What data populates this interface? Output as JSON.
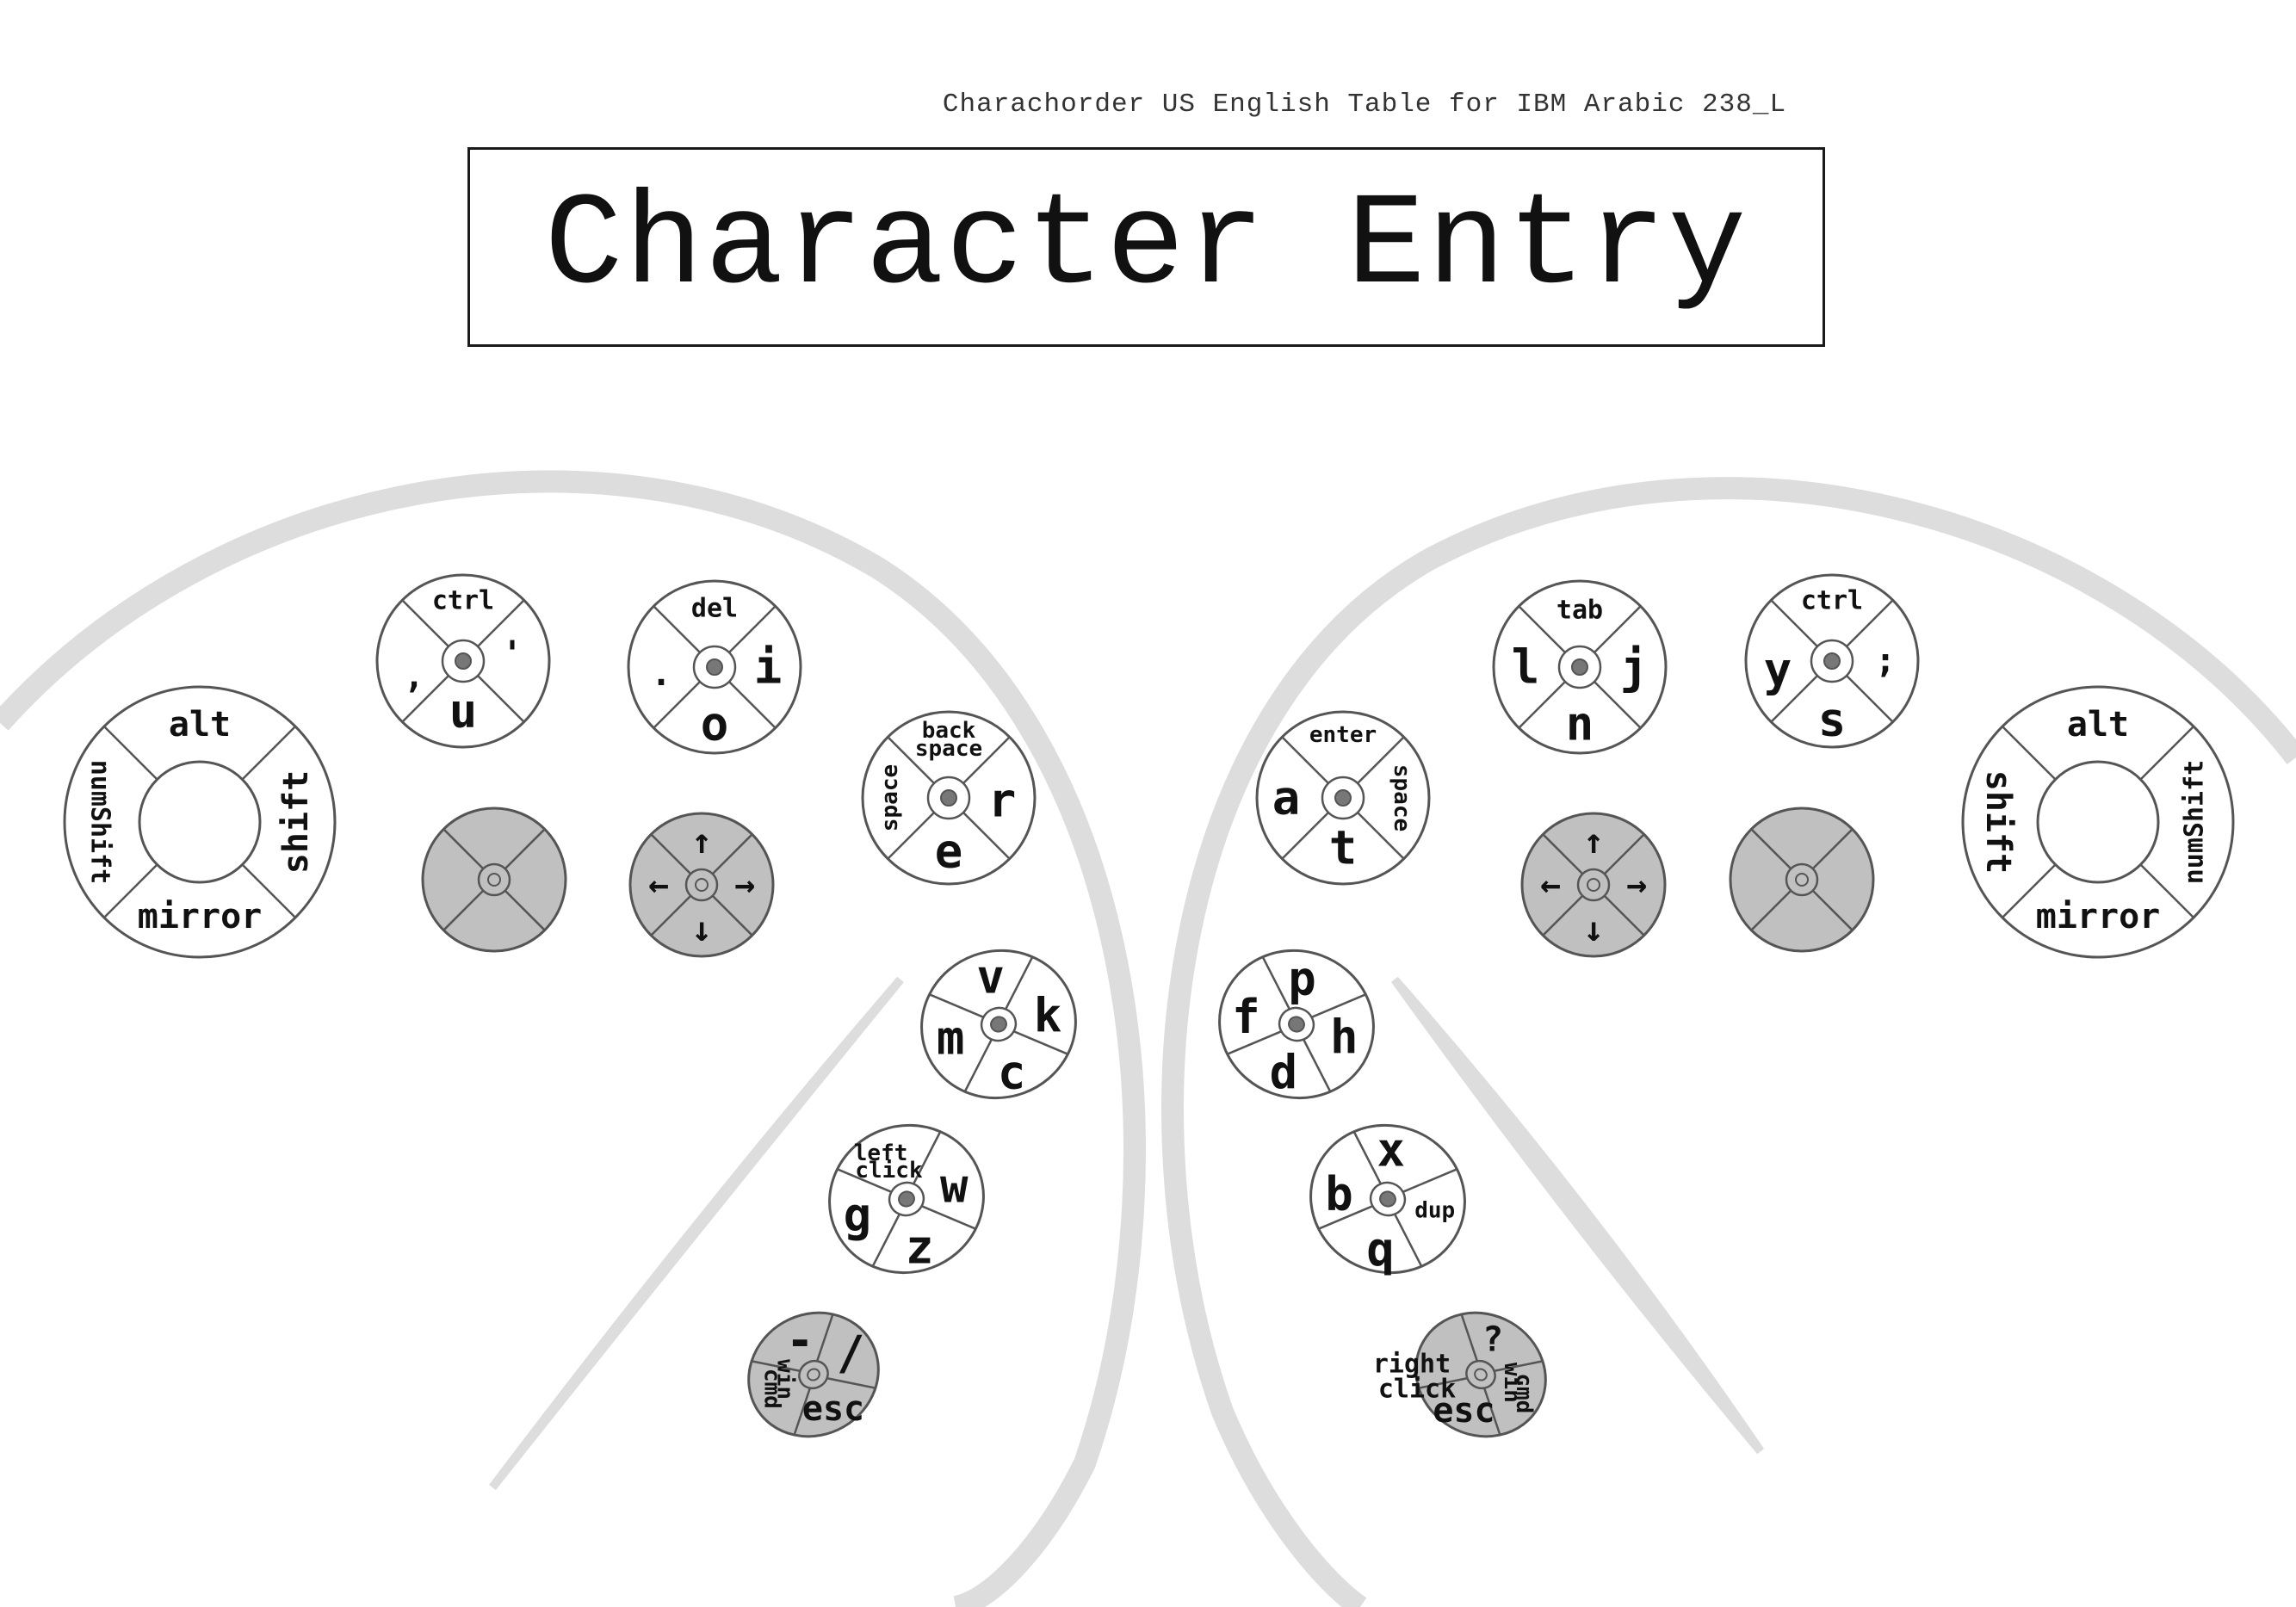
{
  "header": {
    "subtitle": "Charachorder US English Table for IBM Arabic 238_L",
    "title": "Character Entry"
  },
  "colors": {
    "guide_arc": "#dddddd",
    "key_fill": "#ffffff",
    "key_fill_gray": "#c0c0c0",
    "key_stroke": "#555555",
    "center_dot": "#777777"
  },
  "left_hand": {
    "thumb_ring": {
      "top": "alt",
      "right": "shift",
      "bottom": "mirror",
      "left": "numShift"
    },
    "key_ctrl_u": {
      "top": "ctrl",
      "right": "'",
      "bottom": "u",
      "left": ","
    },
    "key_del_o": {
      "top": "del",
      "right": "i",
      "bottom": "o",
      "left": "."
    },
    "key_backspace_e": {
      "top_line1": "back",
      "top_line2": "space",
      "right": "r",
      "bottom": "e",
      "left": "space"
    },
    "blank_key": {
      "type": "gray"
    },
    "arrow_key": {
      "top": "↑",
      "right": "→",
      "bottom": "↓",
      "left": "←"
    },
    "key_v_c": {
      "top": "v",
      "right": "k",
      "bottom": "c",
      "left": "m"
    },
    "key_click_z": {
      "top_line1": "left",
      "top_line2": "click",
      "right": "w",
      "bottom": "z",
      "left": "g"
    },
    "key_esc": {
      "top": "-",
      "right": "/",
      "bottom": "esc",
      "left_line1": "win",
      "left_line2": "cmd"
    }
  },
  "right_hand": {
    "thumb_ring": {
      "top": "alt",
      "right": "numShift",
      "bottom": "mirror",
      "left": "shift"
    },
    "key_tab_n": {
      "top": "tab",
      "right": "j",
      "bottom": "n",
      "left": "l"
    },
    "key_ctrl_s": {
      "top": "ctrl",
      "right": ";",
      "bottom": "s",
      "left": "y"
    },
    "key_enter_t": {
      "top": "enter",
      "right": "space",
      "bottom": "t",
      "left": "a"
    },
    "arrow_key": {
      "top": "↑",
      "right": "→",
      "bottom": "↓",
      "left": "←"
    },
    "blank_key": {
      "type": "gray"
    },
    "key_p_d": {
      "top": "p",
      "right": "h",
      "bottom": "d",
      "left": "f"
    },
    "key_x_q": {
      "top": "x",
      "right": "dup",
      "bottom": "q",
      "left": "b"
    },
    "key_esc": {
      "top": "?",
      "right_line1": "win",
      "right_line2": "cmd",
      "bottom": "esc",
      "left_line1": "right",
      "left_line2": "click"
    }
  }
}
